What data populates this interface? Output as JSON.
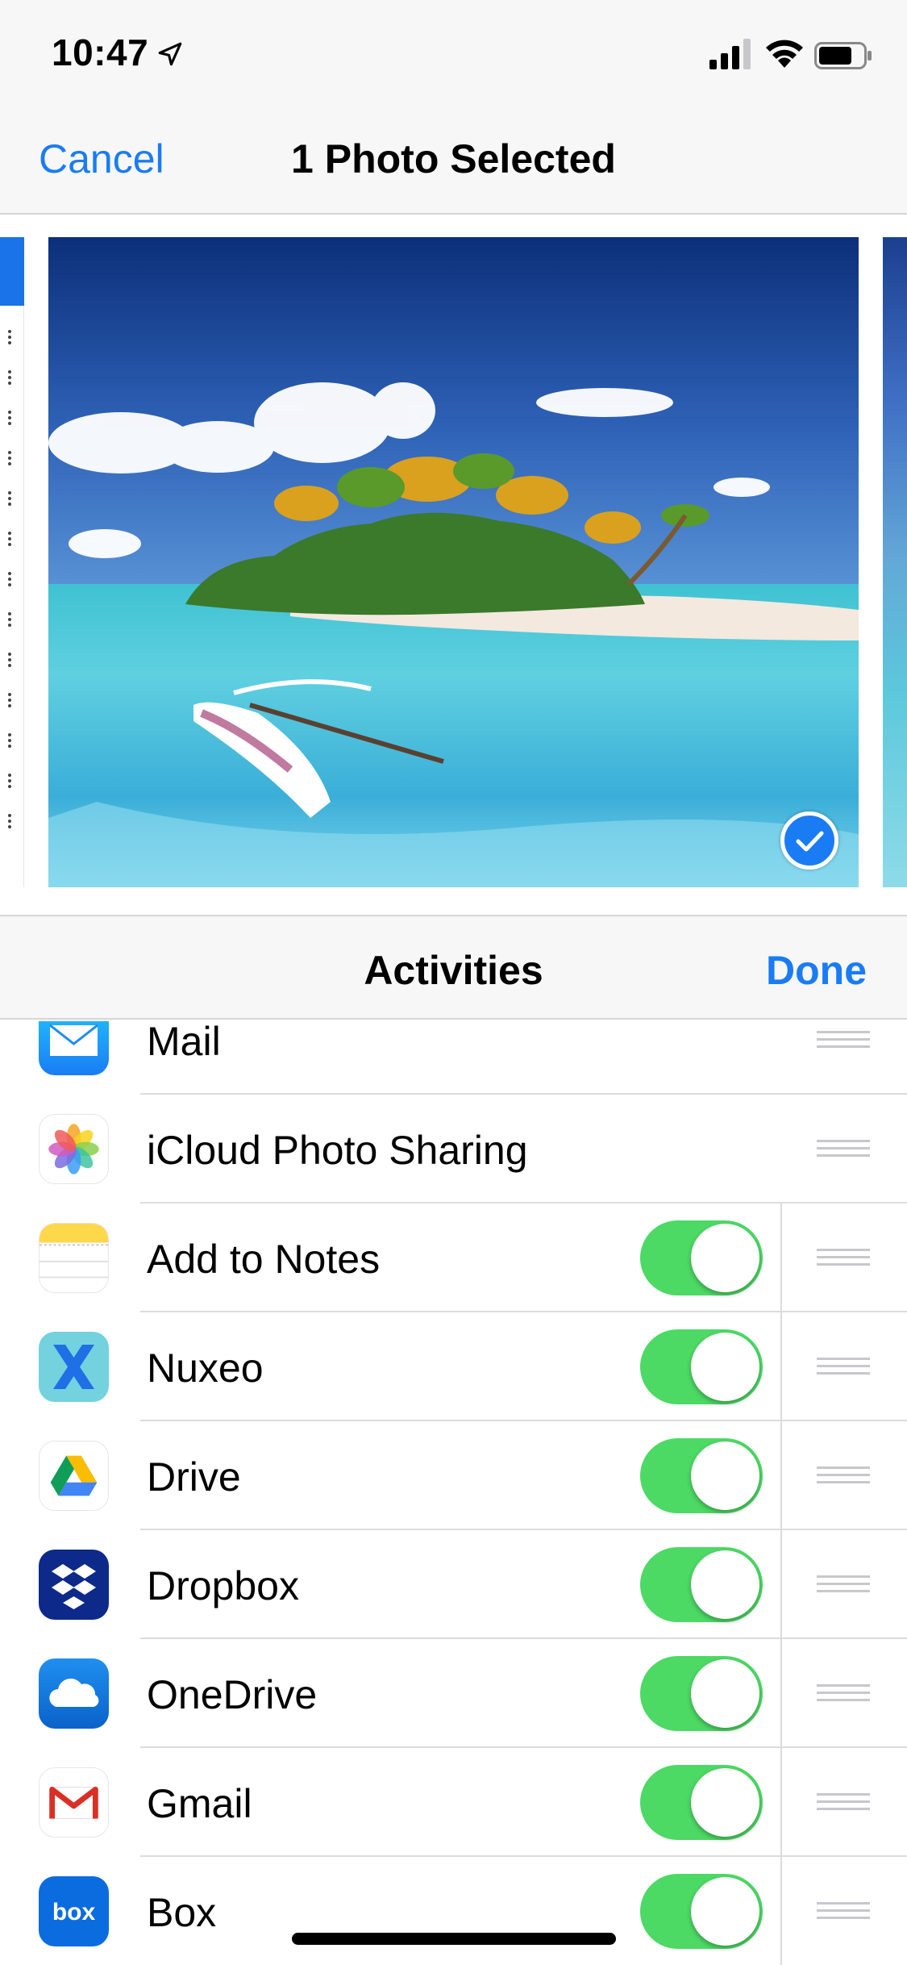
{
  "status_bar": {
    "time": "10:47"
  },
  "nav": {
    "cancel_label": "Cancel",
    "title": "1 Photo Selected"
  },
  "activities": {
    "title": "Activities",
    "done_label": "Done"
  },
  "items": [
    {
      "label": "Mail",
      "icon": "mail-icon",
      "toggle": null
    },
    {
      "label": "iCloud Photo Sharing",
      "icon": "photos-icon",
      "toggle": null
    },
    {
      "label": "Add to Notes",
      "icon": "notes-icon",
      "toggle": true
    },
    {
      "label": "Nuxeo",
      "icon": "nuxeo-icon",
      "toggle": true
    },
    {
      "label": "Drive",
      "icon": "google-drive-icon",
      "toggle": true
    },
    {
      "label": "Dropbox",
      "icon": "dropbox-icon",
      "toggle": true
    },
    {
      "label": "OneDrive",
      "icon": "onedrive-icon",
      "toggle": true
    },
    {
      "label": "Gmail",
      "icon": "gmail-icon",
      "toggle": true
    },
    {
      "label": "Box",
      "icon": "box-icon",
      "toggle": true,
      "icon_text": "box"
    }
  ],
  "colors": {
    "accent": "#1a7cf4",
    "toggle_on": "#4cd964"
  }
}
